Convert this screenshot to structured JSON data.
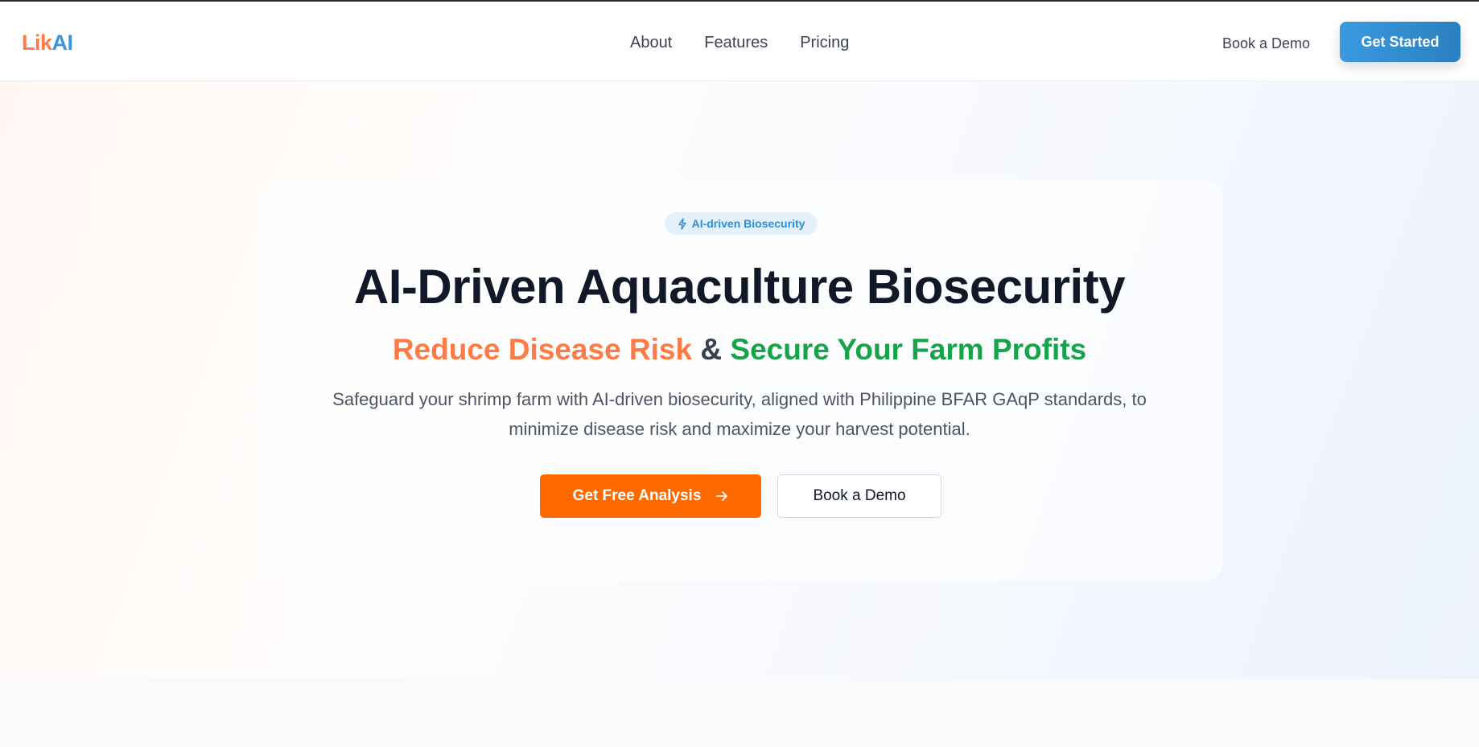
{
  "nav": {
    "logo": {
      "part1": "Lik",
      "part2": "AI"
    },
    "links": [
      "About",
      "Features",
      "Pricing"
    ],
    "book_demo": "Book a Demo",
    "get_started": "Get Started"
  },
  "hero": {
    "badge": "AI-driven Biosecurity",
    "badge_icon": "lightning-icon",
    "title": "AI-Driven Aquaculture Biosecurity",
    "subtitle": {
      "part1": "Reduce Disease Risk",
      "amp": "&",
      "part2": "Secure Your Farm Profits"
    },
    "description": "Safeguard your shrimp farm with AI-driven biosecurity, aligned with Philippine BFAR GAqP standards, to minimize disease risk and maximize your harvest potential.",
    "primary_button": "Get Free Analysis",
    "primary_icon": "arrow-right-icon",
    "secondary_button": "Book a Demo"
  },
  "colors": {
    "accent_orange": "#ff6a00",
    "brand_blue": "#3b95dc",
    "green": "#16a34a"
  }
}
